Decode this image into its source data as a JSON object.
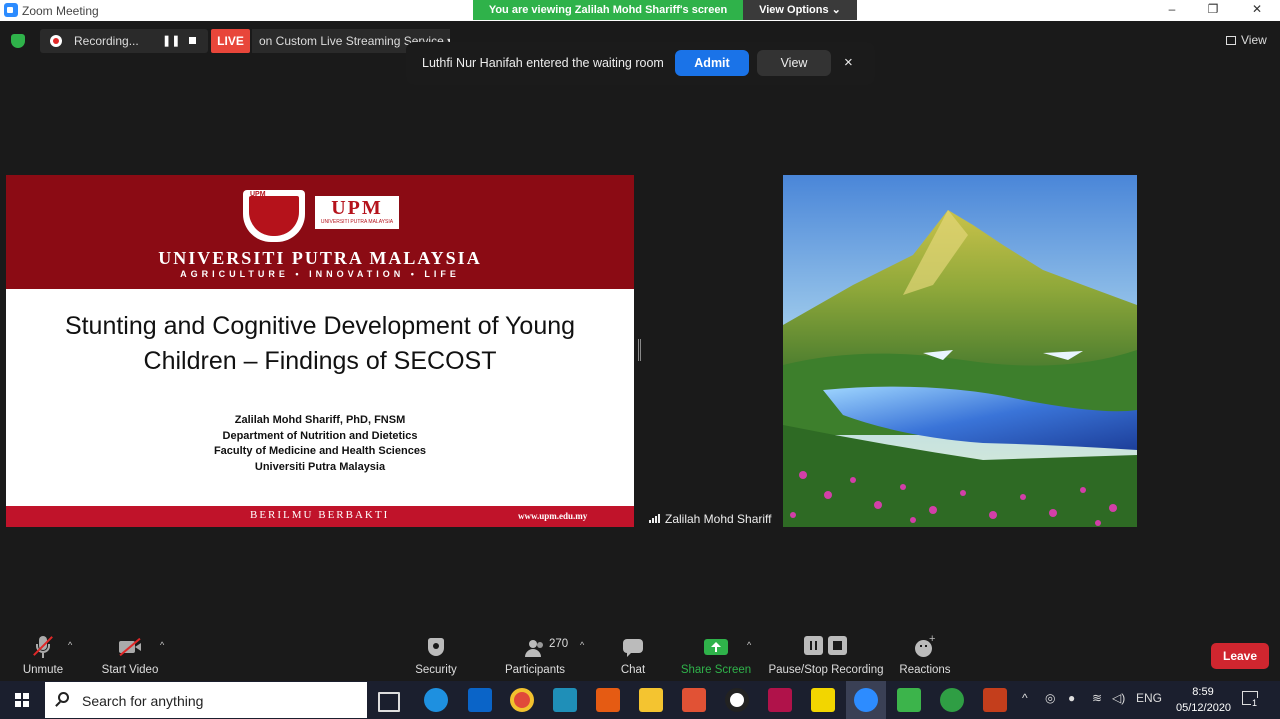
{
  "window": {
    "title": "Zoom Meeting"
  },
  "share_banner": {
    "text": "You are viewing Zalilah Mohd Shariff's screen",
    "options_label": "View Options"
  },
  "window_controls": {
    "minimize": "–",
    "restore": "❐",
    "close": "✕"
  },
  "top_bar": {
    "recording_label": "Recording...",
    "live_badge": "LIVE",
    "live_service": "on Custom Live Streaming Service",
    "view_label": "View"
  },
  "notification": {
    "message": "Luthfi Nur Hanifah entered the waiting room",
    "admit_label": "Admit",
    "view_label": "View",
    "close_label": "×"
  },
  "slide": {
    "logo_text": "UPM",
    "logo_sub": "UNIVERSITI PUTRA MALAYSIA",
    "shield_text": "UPM",
    "university": "UNIVERSITI PUTRA MALAYSIA",
    "tagline": "AGRICULTURE • INNOVATION • LIFE",
    "title_line1": "Stunting and Cognitive Development of Young",
    "title_line2": "Children – Findings of SECOST",
    "author": "Zalilah Mohd Shariff, PhD, FNSM",
    "department": "Department of Nutrition and Dietetics",
    "faculty": "Faculty of Medicine and Health Sciences",
    "institution": "Universiti Putra Malaysia",
    "footer_motto": "BERILMU BERBAKTI",
    "footer_url": "www.upm.edu.my"
  },
  "participant_video": {
    "name": "Zalilah Mohd Shariff"
  },
  "toolbar": {
    "unmute": "Unmute",
    "start_video": "Start Video",
    "security": "Security",
    "participants_count": "270",
    "participants": "Participants",
    "chat": "Chat",
    "share_screen": "Share Screen",
    "pause_stop_recording": "Pause/Stop Recording",
    "reactions": "Reactions",
    "leave": "Leave"
  },
  "taskbar": {
    "search_placeholder": "Search for anything",
    "language": "ENG",
    "time": "8:59",
    "date": "05/12/2020",
    "notification_count": "1"
  },
  "colors": {
    "accent_blue": "#1a73e8",
    "live_red": "#e8463a",
    "share_green": "#2fb24a",
    "leave_red": "#d0262f",
    "upm_maroon": "#8b0b14"
  }
}
